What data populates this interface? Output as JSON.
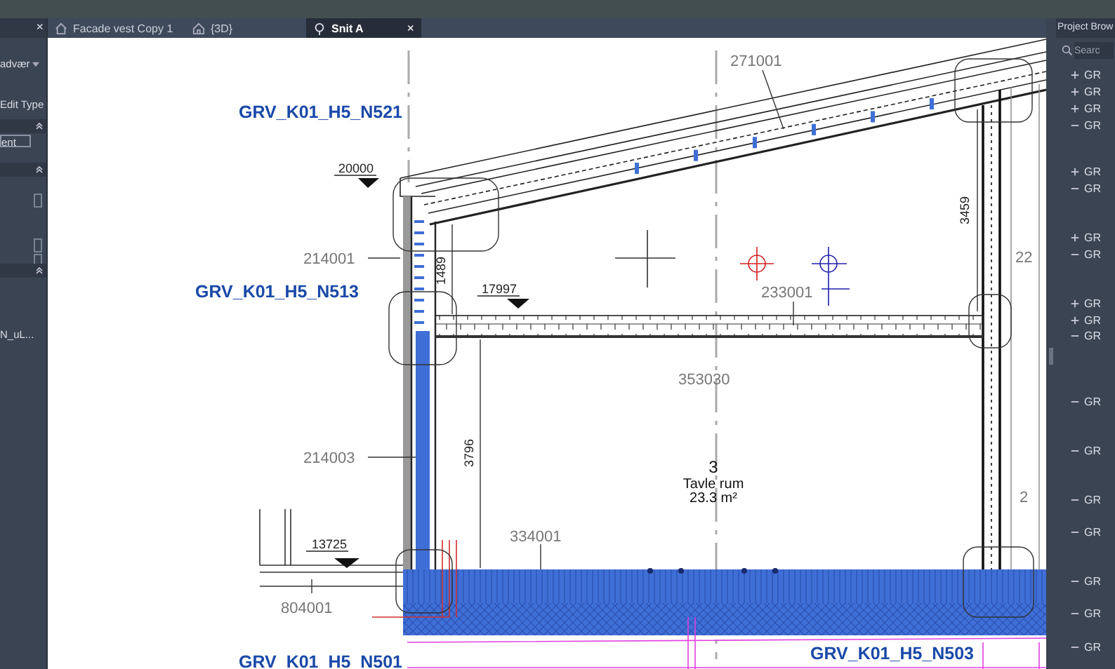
{
  "left_panel": {
    "close": "×",
    "dropdown": "advær",
    "edit_type": "Edit Type",
    "field_value": "ent",
    "item": "N_uL...",
    "checkboxes": [
      {
        "checked": false
      },
      {
        "checked": false
      },
      {
        "checked": false
      }
    ]
  },
  "tabs": [
    {
      "kind": "elevation",
      "label": "Facade vest Copy 1",
      "selected": false
    },
    {
      "kind": "model",
      "label": "{3D}",
      "selected": false
    },
    {
      "kind": "section",
      "label": "Snit A",
      "selected": true,
      "close": "×"
    }
  ],
  "canvas": {
    "labels": [
      {
        "kind": "tag",
        "text": "GRV_K01_H5_N521"
      },
      {
        "kind": "level",
        "text": "20000"
      },
      {
        "kind": "id",
        "text": "271001"
      },
      {
        "kind": "id",
        "text": "214001"
      },
      {
        "kind": "tag",
        "text": "GRV_K01_H5_N513"
      },
      {
        "kind": "dimension",
        "text": "1489"
      },
      {
        "kind": "level",
        "text": "17997"
      },
      {
        "kind": "id",
        "text": "233001"
      },
      {
        "kind": "dimension",
        "text": "3459"
      },
      {
        "kind": "id",
        "text": "22"
      },
      {
        "kind": "id",
        "text": "353030"
      },
      {
        "kind": "id",
        "text": "214003"
      },
      {
        "kind": "dimension",
        "text": "3796"
      },
      {
        "kind": "room-number",
        "text": "3"
      },
      {
        "kind": "room-name",
        "text": "Tavle rum"
      },
      {
        "kind": "room-area",
        "text": "23.3 m²"
      },
      {
        "kind": "id",
        "text": "2"
      },
      {
        "kind": "level",
        "text": "13725"
      },
      {
        "kind": "id",
        "text": "334001"
      },
      {
        "kind": "id",
        "text": "804001"
      },
      {
        "kind": "tag",
        "text": "GRV_K01_H5_N503"
      },
      {
        "kind": "tag",
        "text": "GRV_K01_H5_N501"
      }
    ]
  },
  "project_browser": {
    "title": "Project Brow",
    "search": {
      "placeholder": "Searc"
    },
    "items": [
      {
        "label": "GR",
        "expanded": false
      },
      {
        "label": "GR",
        "expanded": false
      },
      {
        "label": "GR",
        "expanded": false
      },
      {
        "label": "GR",
        "expanded": true
      },
      {
        "label": "GR",
        "expanded": false
      },
      {
        "label": "GR",
        "expanded": true
      },
      {
        "label": "GR",
        "expanded": false
      },
      {
        "label": "GR",
        "expanded": true
      },
      {
        "label": "GR",
        "expanded": false
      },
      {
        "label": "GR",
        "expanded": false
      },
      {
        "label": "GR",
        "expanded": true
      },
      {
        "label": "GR",
        "expanded": true
      },
      {
        "label": "GR",
        "expanded": true
      },
      {
        "label": "GR",
        "expanded": true
      },
      {
        "label": "GR",
        "expanded": true
      },
      {
        "label": "GR",
        "expanded": true
      },
      {
        "label": "GR",
        "expanded": true
      },
      {
        "label": "GR",
        "expanded": true
      }
    ]
  }
}
